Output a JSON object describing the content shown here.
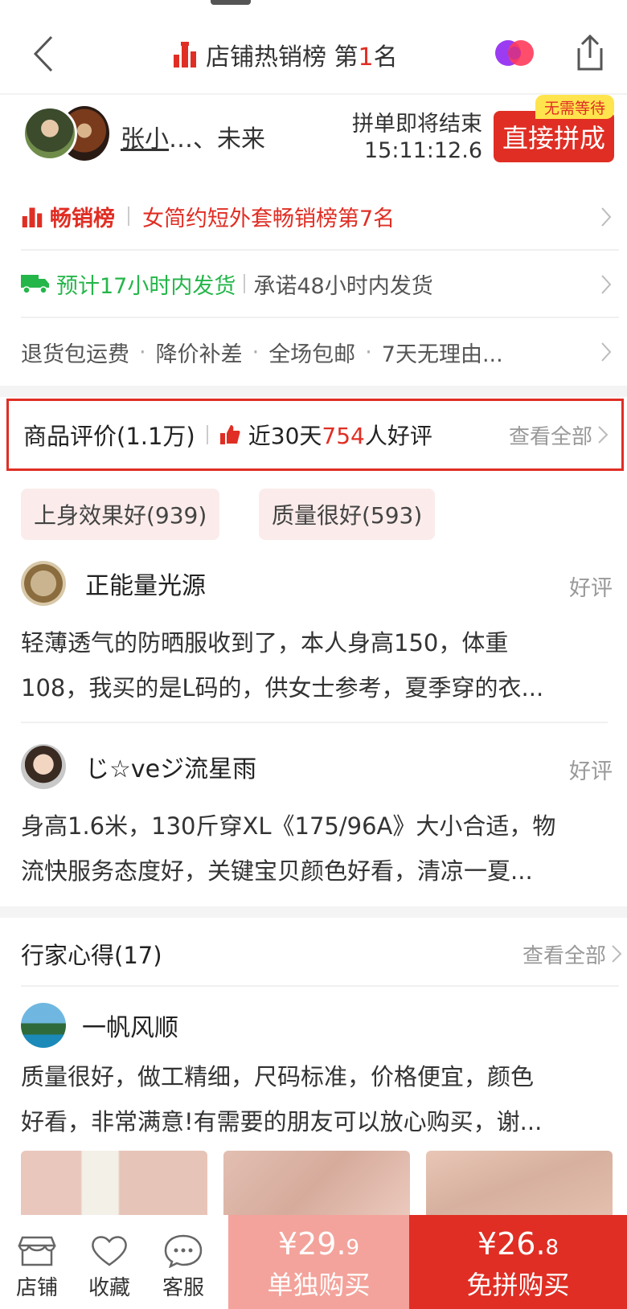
{
  "header": {
    "title_prefix": "店铺热销榜 第",
    "title_rank": "1",
    "title_suffix": "名"
  },
  "group_buy": {
    "names_first": "张小",
    "names_rest": "…、未来",
    "ending_text": "拼单即将结束",
    "timer": "15:11:12.6",
    "join_label": "直接拼成",
    "no_wait_badge": "无需等待"
  },
  "bestseller": {
    "label": "畅销榜",
    "text": "女简约短外套畅销榜第7名"
  },
  "shipping": {
    "estimate": "预计17小时内发货",
    "promise": "承诺48小时内发货"
  },
  "services": [
    "退货包运费",
    "降价补差",
    "全场包邮",
    "7天无理由..."
  ],
  "reviews": {
    "title": "商品评价(1.1万)",
    "recent_prefix": "近30天",
    "recent_count": "754",
    "recent_suffix": "人好评",
    "see_all": "查看全部",
    "tags": [
      "上身效果好(939)",
      "质量很好(593)"
    ],
    "items": [
      {
        "user": "正能量光源",
        "rating": "好评",
        "line1": "轻薄透气的防晒服收到了，本人身高150，体重",
        "line2": "108，我买的是L码的，供女士参考，夏季穿的衣..."
      },
      {
        "user": "じ☆veジ流星雨",
        "rating": "好评",
        "line1": "身高1.6米，130斤穿XL《175/96A》大小合适，物",
        "line2": "流快服务态度好，关键宝贝颜色好看，清凉一夏..."
      }
    ]
  },
  "expert": {
    "title": "行家心得(17)",
    "see_all": "查看全部",
    "user": "一帆风顺",
    "line1": "质量很好，做工精细，尺码标准，价格便宜，颜色",
    "line2": "好看，非常满意!有需要的朋友可以放心购买，谢..."
  },
  "bottom_bar": {
    "store": "店铺",
    "favorite": "收藏",
    "service": "客服",
    "single_price_main": "¥29.",
    "single_price_dec": "9",
    "single_label": "单独购买",
    "group_price_main": "¥26.",
    "group_price_dec": "8",
    "group_label": "免拼购买"
  },
  "colors": {
    "brand_red": "#e02e24",
    "green": "#25b64a",
    "light_red": "#f3a39b"
  }
}
